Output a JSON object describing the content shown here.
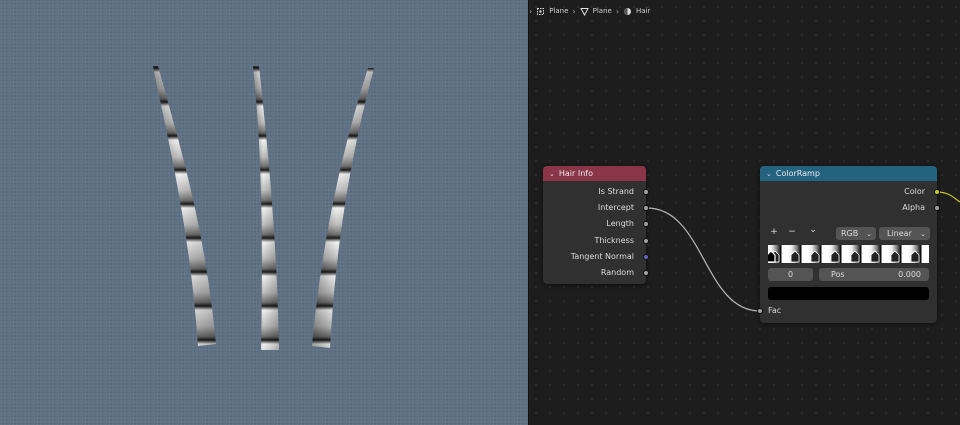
{
  "breadcrumb": {
    "items": [
      "Plane",
      "Plane",
      "Hair"
    ]
  },
  "hair_info": {
    "title": "Hair Info",
    "header_color": "#8b3648",
    "outputs": [
      "Is Strand",
      "Intercept",
      "Length",
      "Thickness",
      "Tangent Normal",
      "Random"
    ],
    "socket_colors": [
      "#a1a1a1",
      "#a1a1a1",
      "#a1a1a1",
      "#a1a1a1",
      "#6363c7",
      "#a1a1a1"
    ]
  },
  "colorramp": {
    "title": "ColorRamp",
    "header_color": "#24637f",
    "outputs": [
      "Color",
      "Alpha"
    ],
    "output_socket_colors": [
      "#c7c729",
      "#a1a1a1"
    ],
    "add_label": "+",
    "remove_label": "−",
    "menu_label": "⌄",
    "color_mode": "RGB",
    "interpolation": "Linear",
    "index_value": "0",
    "pos_label": "Pos",
    "pos_value": "0.000",
    "color_swatch": "#000000",
    "input_label": "Fac"
  }
}
